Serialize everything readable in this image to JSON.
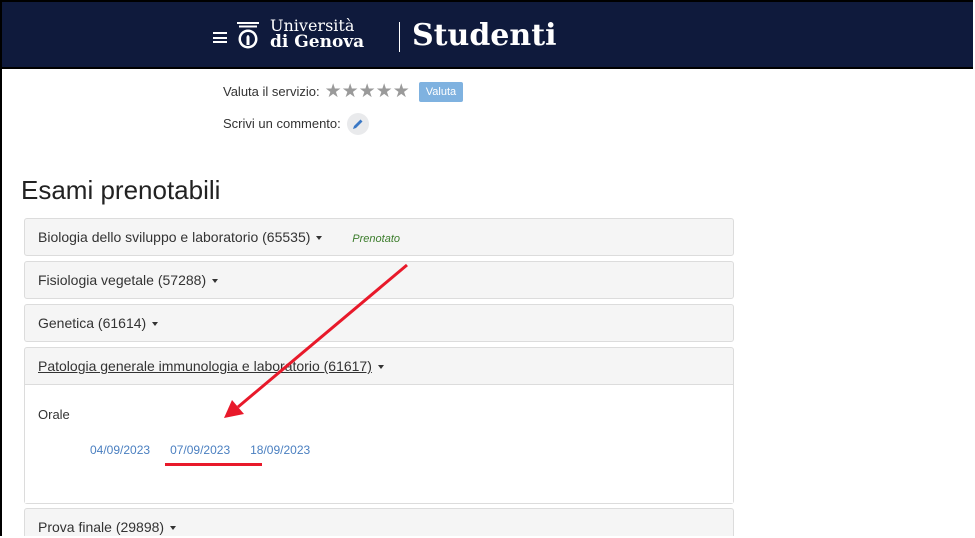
{
  "header": {
    "logo_line1": "Università",
    "logo_line2": "di Genova",
    "app_title": "Studenti"
  },
  "rating": {
    "label": "Valuta il servizio:",
    "stars": "★★★★★",
    "button_label": "Valuta"
  },
  "comment": {
    "label": "Scrivi un commento:"
  },
  "page_title": "Esami prenotabili",
  "exams": [
    {
      "name": "Biologia dello sviluppo e laboratorio (65535)",
      "status": "Prenotato"
    },
    {
      "name": "Fisiologia vegetale (57288)"
    },
    {
      "name": "Genetica (61614)"
    },
    {
      "name": "Patologia generale immunologia e laboratorio (61617)",
      "type": "Orale",
      "dates": [
        "04/09/2023",
        "07/09/2023",
        "18/09/2023"
      ]
    },
    {
      "name": "Prova finale (29898)"
    }
  ],
  "colors": {
    "navbar": "#0f1a3c",
    "link": "#4a7fc0",
    "accent_red": "#e8192a",
    "status_green": "#3c7d2c",
    "rate_button": "#7fb2e0"
  }
}
